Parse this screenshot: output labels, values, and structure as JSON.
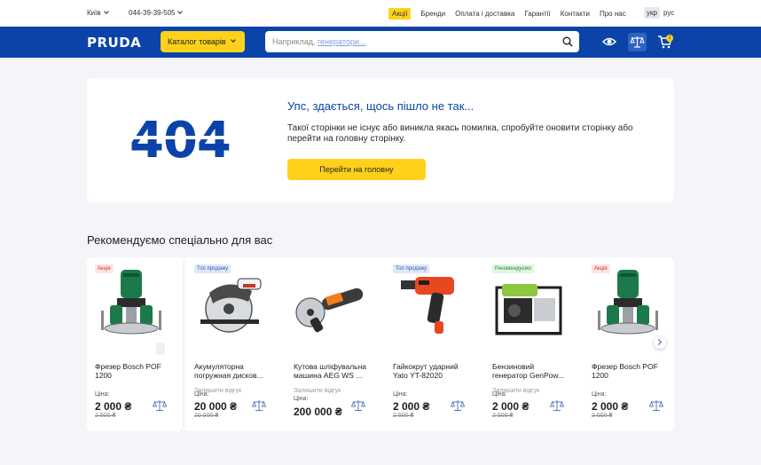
{
  "topbar": {
    "city": "Київ",
    "phone": "044-39-39-505",
    "nav": [
      "Акції",
      "Бренди",
      "Оплата і доставка",
      "Гарантії",
      "Контакти",
      "Про нас"
    ],
    "lang_active": "укр",
    "lang_other": "рус"
  },
  "header": {
    "logo": "PRUDA",
    "catalog_label": "Каталог товарів",
    "search_placeholder_prefix": "Наприклад, ",
    "search_placeholder_link": "генератори...",
    "cart_count": "1",
    "brand_color": "#0c43a8",
    "accent_color": "#ffd11a"
  },
  "error": {
    "code": "404",
    "title": "Упс, здається, щось пішло не так...",
    "text": "Такої сторінки не існує або виникла якась помилка, спробуйте оновити сторінку або перейти на головну сторінку.",
    "button": "Перейти на головну"
  },
  "recommend": {
    "title": "Рекомендуємо спеціально для вас",
    "products": [
      {
        "badge": "Акція",
        "badge_type": "sale",
        "image": "router-tool",
        "name": "Фрезер Bosch POF 1200",
        "review": "",
        "price_label": "Ціна:",
        "price": "2 000 ₴",
        "old_price": "2 500 ₴"
      },
      {
        "badge": "Топ продажу",
        "badge_type": "top",
        "image": "circular-saw",
        "name": "Акумуляторна погружная дисков...",
        "review": "Залишити відгук",
        "price_label": "Ціна:",
        "price": "20 000 ₴",
        "old_price": "20 500 ₴"
      },
      {
        "badge": "",
        "badge_type": "",
        "image": "angle-grinder",
        "name": "Кутова шліфувальна машина AEG WS ...",
        "review": "Залишити відгук",
        "price_label": "Ціна:",
        "price": "200 000 ₴",
        "old_price": ""
      },
      {
        "badge": "Топ продажу",
        "badge_type": "top",
        "image": "impact-wrench",
        "name": "Гайкокрут ударний Yato YT-82020",
        "review": "",
        "price_label": "Ціна:",
        "price": "2 000 ₴",
        "old_price": "2 500 ₴"
      },
      {
        "badge": "Рекомендуємо",
        "badge_type": "rec",
        "image": "generator",
        "name": "Бензиновий генератор GenPow...",
        "review": "Залишити відгук",
        "price_label": "Ціна:",
        "price": "2 000 ₴",
        "old_price": "2 500 ₴"
      },
      {
        "badge": "Акція",
        "badge_type": "sale",
        "image": "router-tool",
        "name": "Фрезер Bosch POF 1200",
        "review": "",
        "price_label": "Ціна:",
        "price": "2 000 ₴",
        "old_price": "2 500 ₴"
      }
    ]
  }
}
